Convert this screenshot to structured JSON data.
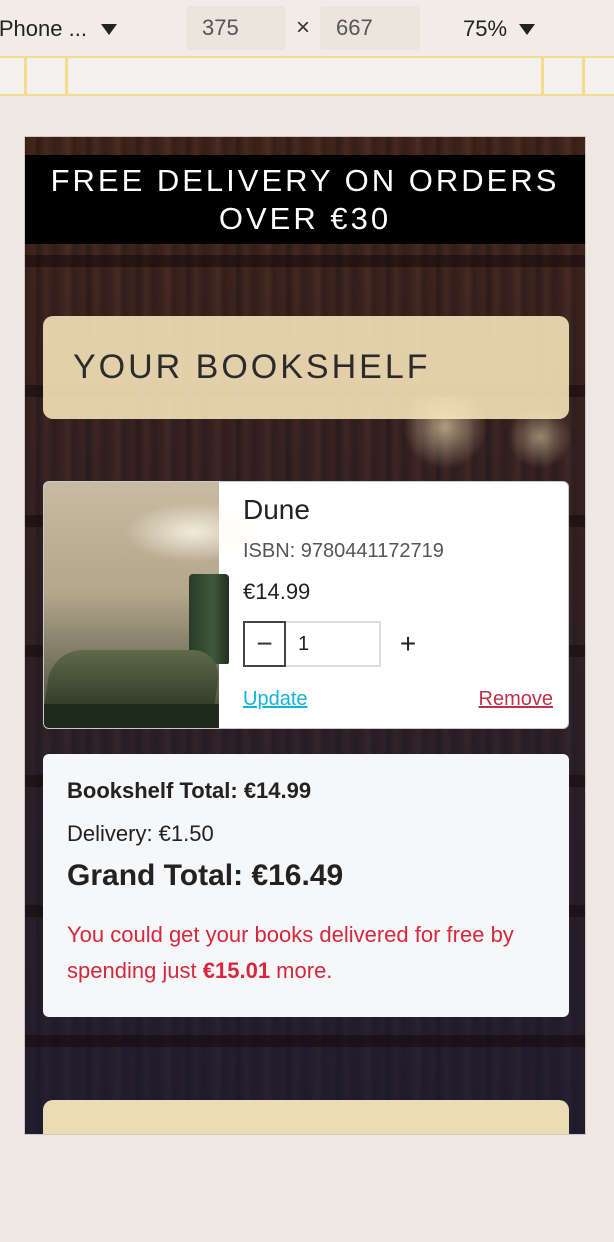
{
  "devtools": {
    "device_name": "iPhone ...",
    "width": "375",
    "times": "×",
    "height": "667",
    "zoom": "75%"
  },
  "page": {
    "promo_banner": "FREE DELIVERY ON ORDERS OVER €30",
    "heading": "YOUR BOOKSHELF",
    "items": [
      {
        "title": "Dune",
        "isbn": "ISBN: 9780441172719",
        "price": "€14.99",
        "quantity": "1",
        "update_label": "Update",
        "remove_label": "Remove"
      }
    ],
    "totals": {
      "bookshelf_total": "Bookshelf Total: €14.99",
      "delivery": "Delivery: €1.50",
      "grand_total": "Grand Total: €16.49",
      "free_msg_prefix": "You could get your books delivered for free by spending just ",
      "free_msg_amount": "€15.01",
      "free_msg_suffix": " more."
    }
  },
  "icons": {
    "minus": "minus-icon",
    "plus": "plus-icon",
    "caret": "chevron-down-icon"
  },
  "colors": {
    "banner_bg": "#000000",
    "heading_card_bg": "#fae8be",
    "update_link": "#12b4d6",
    "remove_link": "#c0304a",
    "free_delivery_msg": "#d6283c"
  }
}
